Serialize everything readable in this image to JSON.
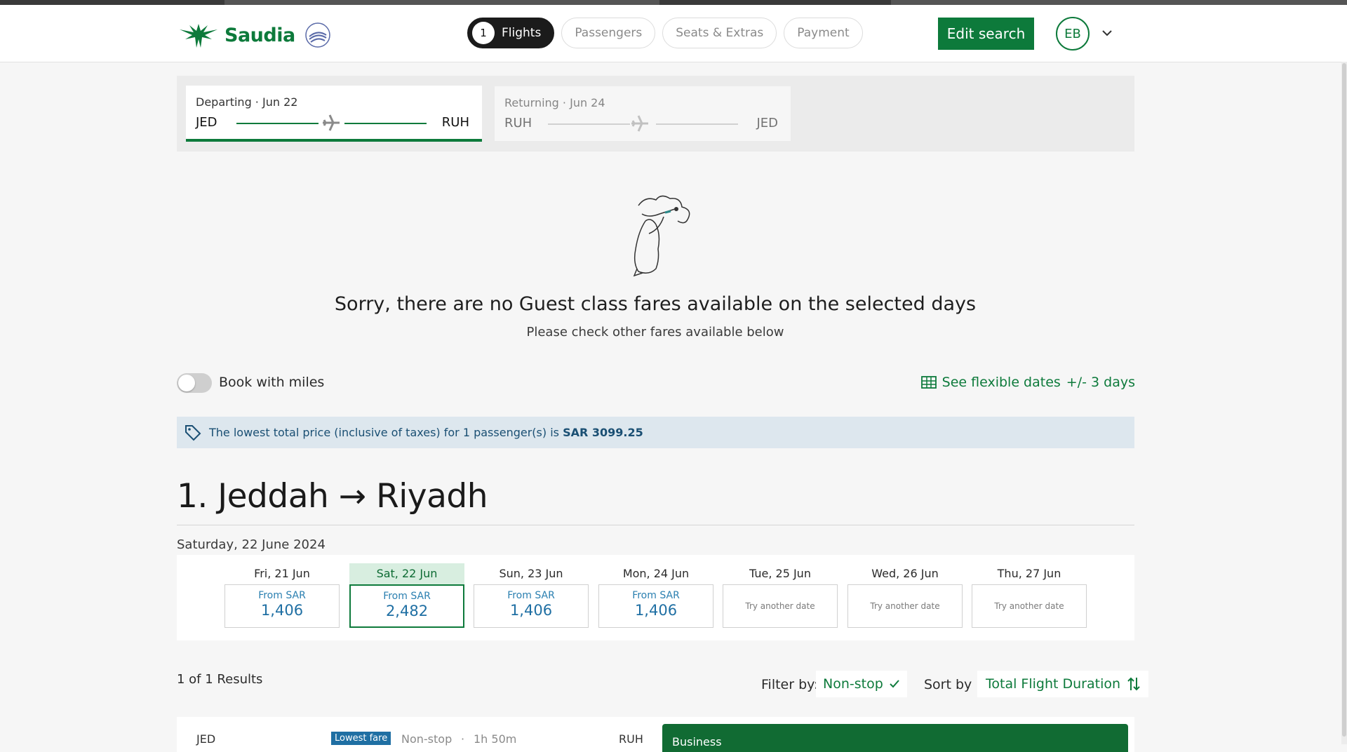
{
  "header": {
    "brand": "Saudia",
    "steps": [
      {
        "num": "1",
        "label": "Flights"
      },
      {
        "label": "Passengers"
      },
      {
        "label": "Seats & Extras"
      },
      {
        "label": "Payment"
      }
    ],
    "edit_search": "Edit search",
    "avatar_initials": "EB"
  },
  "trips": {
    "departing": {
      "label": "Departing · Jun 22",
      "from": "JED",
      "to": "RUH"
    },
    "returning": {
      "label": "Returning · Jun 24",
      "from": "RUH",
      "to": "JED"
    }
  },
  "empty_state": {
    "title": "Sorry, there are no Guest class fares available on the selected days",
    "subtitle": "Please check other fares available below"
  },
  "controls": {
    "book_with_miles": "Book with miles",
    "flex_dates": "See flexible dates",
    "flex_range": "+/- 3 days"
  },
  "price_banner": {
    "text": "The lowest total price (inclusive of taxes) for 1 passenger(s) is ",
    "amount": "SAR 3099.25"
  },
  "route": {
    "title": "1. Jeddah → Riyadh",
    "date": "Saturday, 22 June 2024"
  },
  "days": [
    {
      "name": "Fri, 21 Jun",
      "from": "From SAR",
      "price": "1,406"
    },
    {
      "name": "Sat, 22 Jun",
      "from": "From SAR",
      "price": "2,482"
    },
    {
      "name": "Sun, 23 Jun",
      "from": "From SAR",
      "price": "1,406"
    },
    {
      "name": "Mon, 24 Jun",
      "from": "From SAR",
      "price": "1,406"
    },
    {
      "name": "Tue, 25 Jun",
      "try": "Try another date"
    },
    {
      "name": "Wed, 26 Jun",
      "try": "Try another date"
    },
    {
      "name": "Thu, 27 Jun",
      "try": "Try another date"
    }
  ],
  "results": {
    "count": "1 of 1 Results",
    "filter_label": "Filter by:",
    "filter_value": "Non-stop",
    "sort_label": "Sort by :",
    "sort_value": "Total Flight Duration"
  },
  "result_card": {
    "from": "JED",
    "badge": "Lowest fare",
    "stops": "Non-stop",
    "dot": "·",
    "duration": "1h 50m",
    "to": "RUH",
    "cabin": "Business"
  },
  "colors": {
    "brand_green": "#0d7a3b",
    "link_blue": "#1f6fa3",
    "banner_bg": "#dde7ee"
  }
}
